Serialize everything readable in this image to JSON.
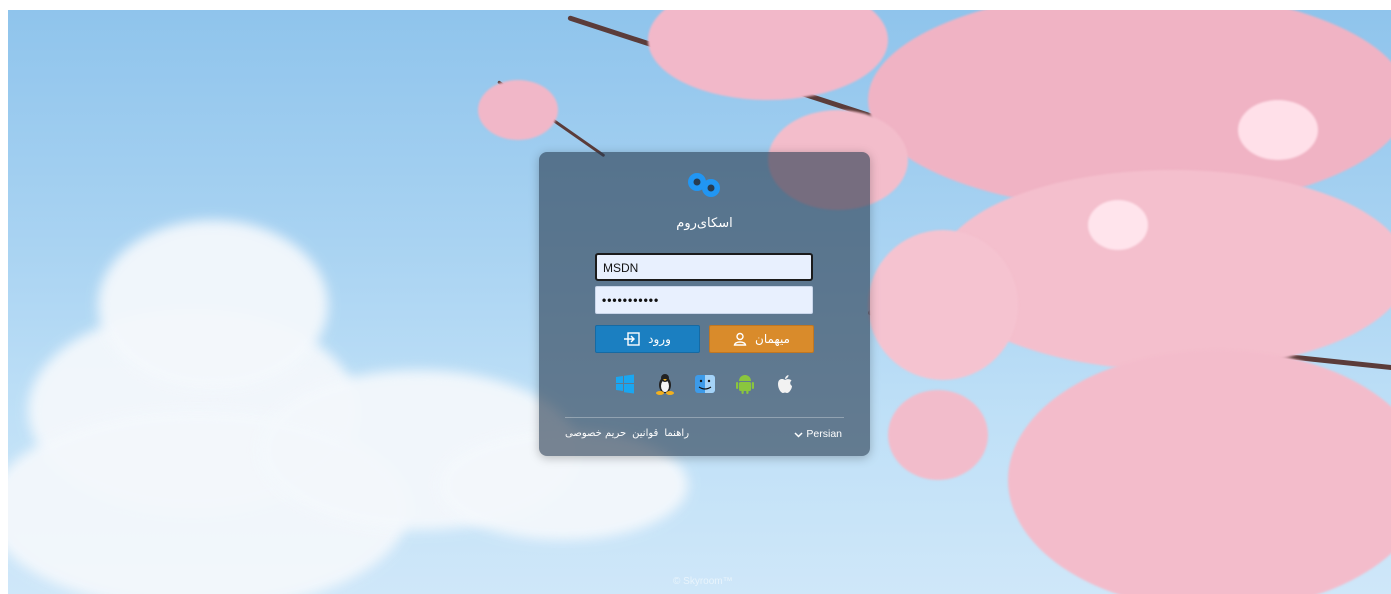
{
  "brand": {
    "name": "اسکای‌روم"
  },
  "login": {
    "username_value": "MSDN",
    "password_value": "•••••••••••",
    "guest_label": "میهمان",
    "login_label": "ورود"
  },
  "platforms": [
    "windows-icon",
    "linux-icon",
    "macos-finder-icon",
    "android-icon",
    "apple-icon"
  ],
  "links": {
    "guide": "راهنما",
    "rules": "قوانین",
    "privacy": "حریم خصوصی"
  },
  "language": {
    "selected": "Persian"
  },
  "footer": {
    "copyright": "© Skyroom™"
  },
  "colors": {
    "card": "#283c50",
    "guest_button": "#d98b2b",
    "login_button": "#1b7fc1",
    "input_bg": "#e8f0fe",
    "logo": "#2196f3"
  }
}
